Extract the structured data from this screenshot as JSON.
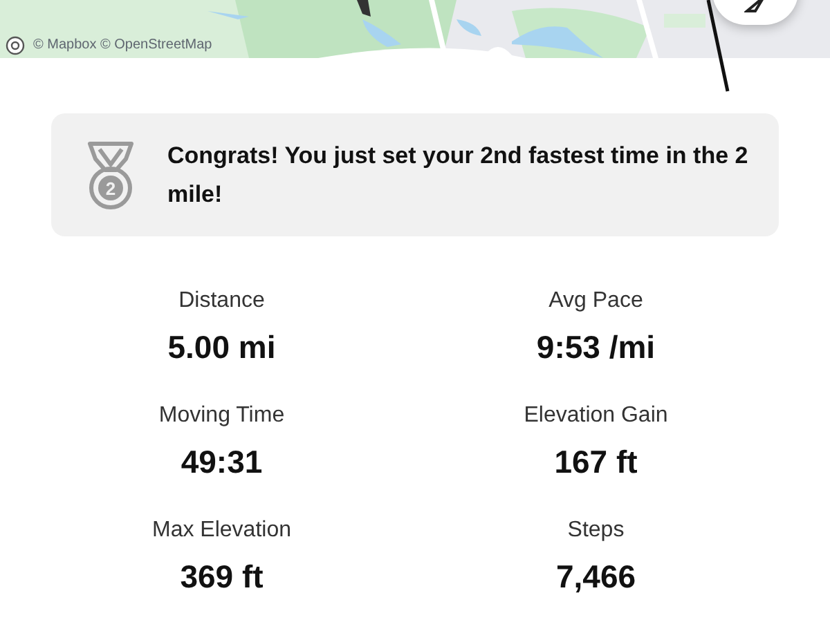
{
  "map": {
    "kind": "picture",
    "attribution": "© Mapbox © OpenStreetMap"
  },
  "achievement": {
    "medal_number": "2",
    "message": "Congrats! You just set your 2nd fastest time in the 2 mile!"
  },
  "stats": [
    {
      "label": "Distance",
      "value": "5.00 mi"
    },
    {
      "label": "Avg Pace",
      "value": "9:53 /mi"
    },
    {
      "label": "Moving Time",
      "value": "49:31"
    },
    {
      "label": "Elevation Gain",
      "value": "167 ft"
    },
    {
      "label": "Max Elevation",
      "value": "369 ft"
    },
    {
      "label": "Steps",
      "value": "7,466"
    }
  ]
}
